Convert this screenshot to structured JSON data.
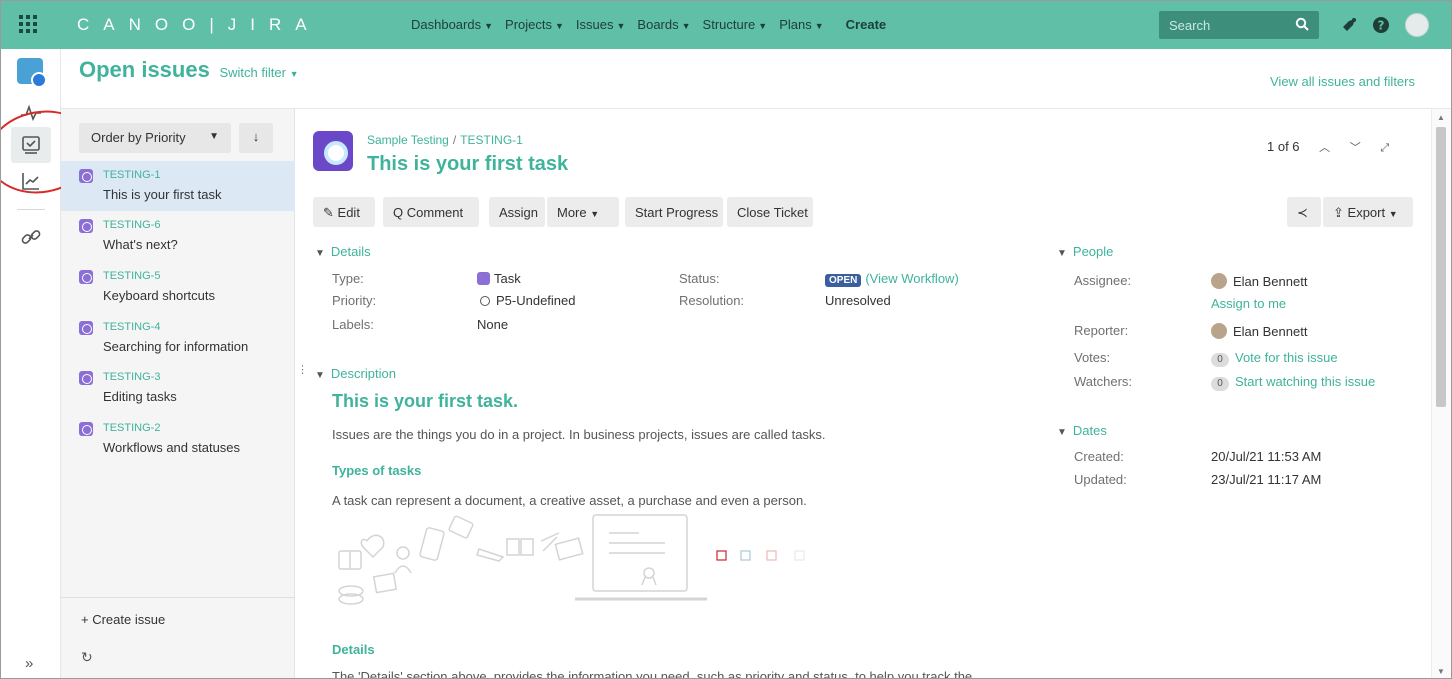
{
  "topbar": {
    "logo_text": "CANOO|JIRA",
    "nav": [
      {
        "label": "Dashboards"
      },
      {
        "label": "Projects"
      },
      {
        "label": "Issues"
      },
      {
        "label": "Boards"
      },
      {
        "label": "Structure"
      },
      {
        "label": "Plans"
      }
    ],
    "create_label": "Create",
    "search_placeholder": "Search",
    "colors": {
      "bar": "#5fbfa7",
      "search": "#3d8f7c"
    }
  },
  "header": {
    "title": "Open issues",
    "switch_filter": "Switch filter",
    "view_all": "View all issues and filters"
  },
  "issue_list": {
    "order_by": "Order by Priority",
    "order_dir": "↓",
    "items": [
      {
        "key": "TESTING-1",
        "summary": "This is your first task"
      },
      {
        "key": "TESTING-6",
        "summary": "What's next?"
      },
      {
        "key": "TESTING-5",
        "summary": "Keyboard shortcuts"
      },
      {
        "key": "TESTING-4",
        "summary": "Searching for information"
      },
      {
        "key": "TESTING-3",
        "summary": "Editing tasks"
      },
      {
        "key": "TESTING-2",
        "summary": "Workflows and statuses"
      }
    ],
    "create_issue": "+ Create issue"
  },
  "issue": {
    "project": "Sample Testing",
    "key": "TESTING-1",
    "title": "This is your first task",
    "pager": "1 of 6",
    "toolbar": {
      "edit": "Edit",
      "comment": "Comment",
      "assign": "Assign",
      "more": "More",
      "start_progress": "Start Progress",
      "close_ticket": "Close Ticket",
      "export": "Export"
    },
    "details": {
      "section": "Details",
      "type_label": "Type:",
      "type_value": "Task",
      "priority_label": "Priority:",
      "priority_value": "P5-Undefined",
      "labels_label": "Labels:",
      "labels_value": "None",
      "status_label": "Status:",
      "status_value": "OPEN",
      "view_workflow": "(View Workflow)",
      "resolution_label": "Resolution:",
      "resolution_value": "Unresolved"
    },
    "people": {
      "section": "People",
      "assignee_label": "Assignee:",
      "assignee": "Elan Bennett",
      "assign_to_me": "Assign to me",
      "reporter_label": "Reporter:",
      "reporter": "Elan Bennett",
      "votes_label": "Votes:",
      "votes_count": "0",
      "vote_link": "Vote for this issue",
      "watchers_label": "Watchers:",
      "watchers_count": "0",
      "watch_link": "Start watching this issue"
    },
    "dates": {
      "section": "Dates",
      "created_label": "Created:",
      "created": "20/Jul/21 11:53 AM",
      "updated_label": "Updated:",
      "updated": "23/Jul/21 11:17 AM"
    },
    "description": {
      "section": "Description",
      "heading": "This is your first task.",
      "p1": "Issues are the things you do in a project. In business projects, issues are called tasks.",
      "sub1": "Types of tasks",
      "p2": "A task can represent a document, a creative asset, a purchase and even a person.",
      "sub2": "Details",
      "p3": "The 'Details' section above, provides the information you need, such as priority and status, to help you track the"
    }
  }
}
